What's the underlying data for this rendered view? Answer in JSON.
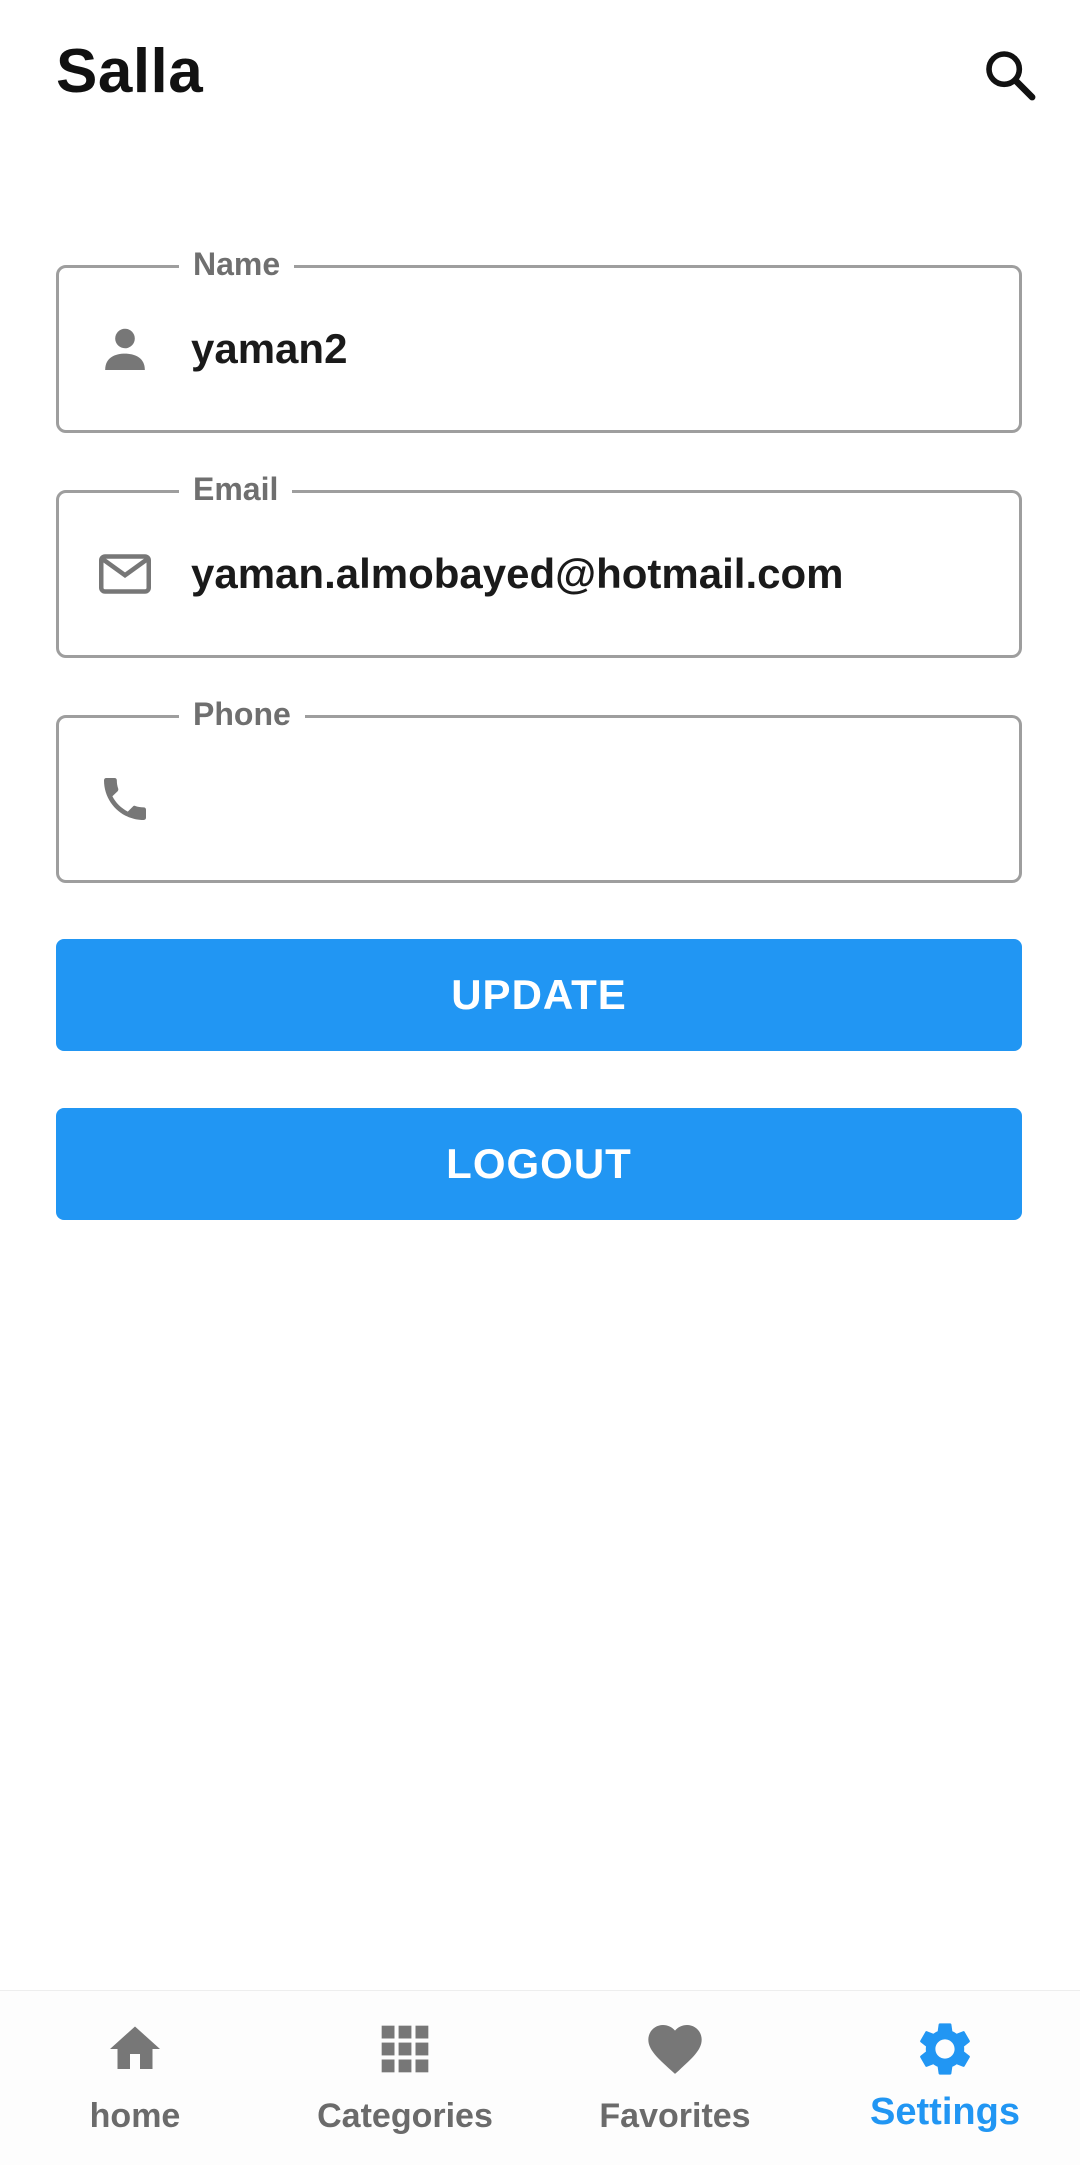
{
  "app": {
    "title": "Salla"
  },
  "colors": {
    "accent": "#2196f3",
    "icon_gray": "#777777",
    "border_gray": "#9e9e9e"
  },
  "form": {
    "name": {
      "label": "Name",
      "value": "yaman2",
      "icon": "person-icon"
    },
    "email": {
      "label": "Email",
      "value": "yaman.almobayed@hotmail.com",
      "icon": "mail-icon"
    },
    "phone": {
      "label": "Phone",
      "value": "",
      "icon": "phone-icon"
    }
  },
  "buttons": {
    "update": "UPDATE",
    "logout": "LOGOUT"
  },
  "bottom_nav": {
    "items": [
      {
        "label": "home",
        "icon": "home-icon",
        "active": false
      },
      {
        "label": "Categories",
        "icon": "grid-icon",
        "active": false
      },
      {
        "label": "Favorites",
        "icon": "heart-icon",
        "active": false
      },
      {
        "label": "Settings",
        "icon": "gear-icon",
        "active": true
      }
    ]
  }
}
